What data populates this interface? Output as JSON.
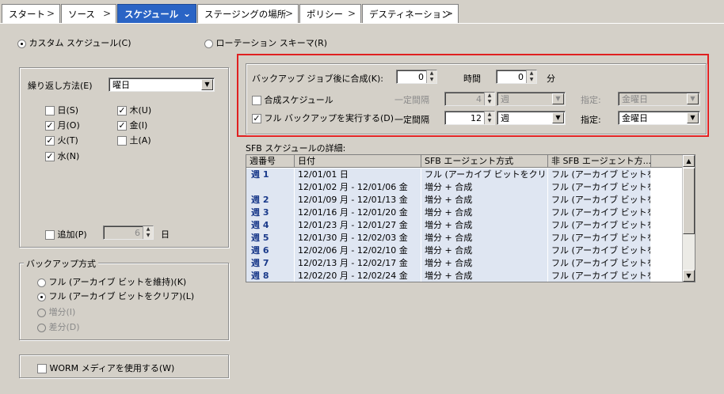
{
  "tabs": [
    {
      "label": "スタート"
    },
    {
      "label": "ソース"
    },
    {
      "label": "スケジュール"
    },
    {
      "label": "ステージングの場所"
    },
    {
      "label": "ポリシー"
    },
    {
      "label": "デスティネーション"
    }
  ],
  "mode": {
    "custom": "カスタム スケジュール(C)",
    "rotation": "ローテーション スキーマ(R)"
  },
  "repeat": {
    "label": "繰り返し方法(E)",
    "value": "曜日",
    "days": {
      "sun": "日(S)",
      "mon": "月(O)",
      "tue": "火(T)",
      "wed": "水(N)",
      "thu": "木(U)",
      "fri": "金(I)",
      "sat": "土(A)"
    },
    "add_label": "追加(P)",
    "add_value": "6",
    "add_unit": "日"
  },
  "backup_method": {
    "title": "バックアップ方式",
    "options": {
      "full_keep": "フル (アーカイブ ビットを維持)(K)",
      "full_clear": "フル (アーカイブ ビットをクリア)(L)",
      "incremental": "増分(I)",
      "differential": "差分(D)"
    }
  },
  "worm": "WORM メディアを使用する(W)",
  "synth": {
    "merge_label": "バックアップ ジョブ後に合成(K):",
    "hours_value": "0",
    "hours_unit": "時間",
    "minutes_value": "0",
    "minutes_unit": "分",
    "synth_schedule": "合成スケジュール",
    "full_backup": "フル バックアップを実行する(D)",
    "interval_label": "一定間隔",
    "specify_label": "指定:",
    "row1": {
      "interval": "4",
      "unit": "週",
      "day": "金曜日"
    },
    "row2": {
      "interval": "12",
      "unit": "週",
      "day": "金曜日"
    }
  },
  "detail": {
    "title": "SFB スケジュールの詳細:",
    "columns": [
      "週番号",
      "日付",
      "SFB エージェント方式",
      "非 SFB エージェント方..."
    ],
    "rows": [
      {
        "week": "週 1",
        "date": "12/01/01 日",
        "sfb": "フル (アーカイブ ビットをクリア)",
        "nonsfb": "フル (アーカイブ ビットを..."
      },
      {
        "week": "",
        "date": "12/01/02 月 - 12/01/06 金",
        "sfb": "増分 + 合成",
        "nonsfb": "フル (アーカイブ ビットを..."
      },
      {
        "week": "週 2",
        "date": "12/01/09 月 - 12/01/13 金",
        "sfb": "増分 + 合成",
        "nonsfb": "フル (アーカイブ ビットを..."
      },
      {
        "week": "週 3",
        "date": "12/01/16 月 - 12/01/20 金",
        "sfb": "増分 + 合成",
        "nonsfb": "フル (アーカイブ ビットを..."
      },
      {
        "week": "週 4",
        "date": "12/01/23 月 - 12/01/27 金",
        "sfb": "増分 + 合成",
        "nonsfb": "フル (アーカイブ ビットを..."
      },
      {
        "week": "週 5",
        "date": "12/01/30 月 - 12/02/03 金",
        "sfb": "増分 + 合成",
        "nonsfb": "フル (アーカイブ ビットを..."
      },
      {
        "week": "週 6",
        "date": "12/02/06 月 - 12/02/10 金",
        "sfb": "増分 + 合成",
        "nonsfb": "フル (アーカイブ ビットを..."
      },
      {
        "week": "週 7",
        "date": "12/02/13 月 - 12/02/17 金",
        "sfb": "増分 + 合成",
        "nonsfb": "フル (アーカイブ ビットを..."
      },
      {
        "week": "週 8",
        "date": "12/02/20 月 - 12/02/24 金",
        "sfb": "増分 + 合成",
        "nonsfb": "フル (アーカイブ ビットを..."
      }
    ]
  },
  "colors": {
    "highlight_frame": "#e02020",
    "active_tab": "#2a64c5",
    "row_bg": "#dfe6f2"
  }
}
